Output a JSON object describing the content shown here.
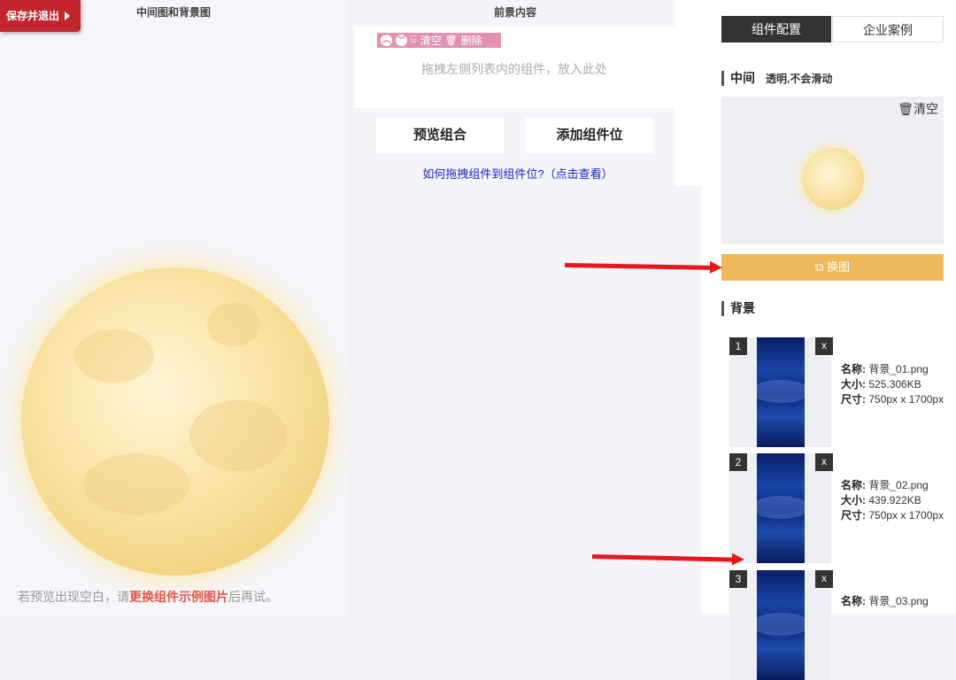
{
  "toolbar": {
    "save_exit_label": "保存并退出"
  },
  "left_pane": {
    "title": "中间图和背景图",
    "hint_prefix": "若预览出现空白，请",
    "hint_link": "更换组件示例图片",
    "hint_suffix": "后再试。"
  },
  "foreground": {
    "title": "前景内容",
    "tools": {
      "clear_label": "清空",
      "delete_label": "删除"
    },
    "placeholder": "拖拽左侧列表内的组件，放入此处",
    "preview_button": "预览组合",
    "add_slot_button": "添加组件位",
    "howto_link": "如何拖拽组件到组件位?（点击查看）"
  },
  "panel": {
    "tabs": [
      {
        "label": "组件配置",
        "active": true
      },
      {
        "label": "企业案例",
        "active": false
      }
    ],
    "middle": {
      "label": "中间",
      "sub": "透明,不会滑动",
      "clear_label": "清空"
    },
    "replace_button": "换图",
    "background": {
      "label": "背景",
      "items": [
        {
          "num": "1",
          "name_label": "名称:",
          "name": "背景_01.png",
          "size_label": "大小:",
          "size": "525.306KB",
          "dim_label": "尺寸:",
          "dim": "750px x 1700px"
        },
        {
          "num": "2",
          "name_label": "名称:",
          "name": "背景_02.png",
          "size_label": "大小:",
          "size": "439.922KB",
          "dim_label": "尺寸:",
          "dim": "750px x 1700px"
        },
        {
          "num": "3",
          "name_label": "名称:",
          "name": "背景_03.png",
          "size_label": "大小:",
          "size": "",
          "dim_label": "",
          "dim": ""
        }
      ],
      "remove_label": "x"
    }
  },
  "colors": {
    "save_bg": "#c4262f",
    "replace_bg": "#efb95b",
    "tool_bg": "#e291b1",
    "link": "#1a22c8",
    "arrow": "#e5191d"
  }
}
